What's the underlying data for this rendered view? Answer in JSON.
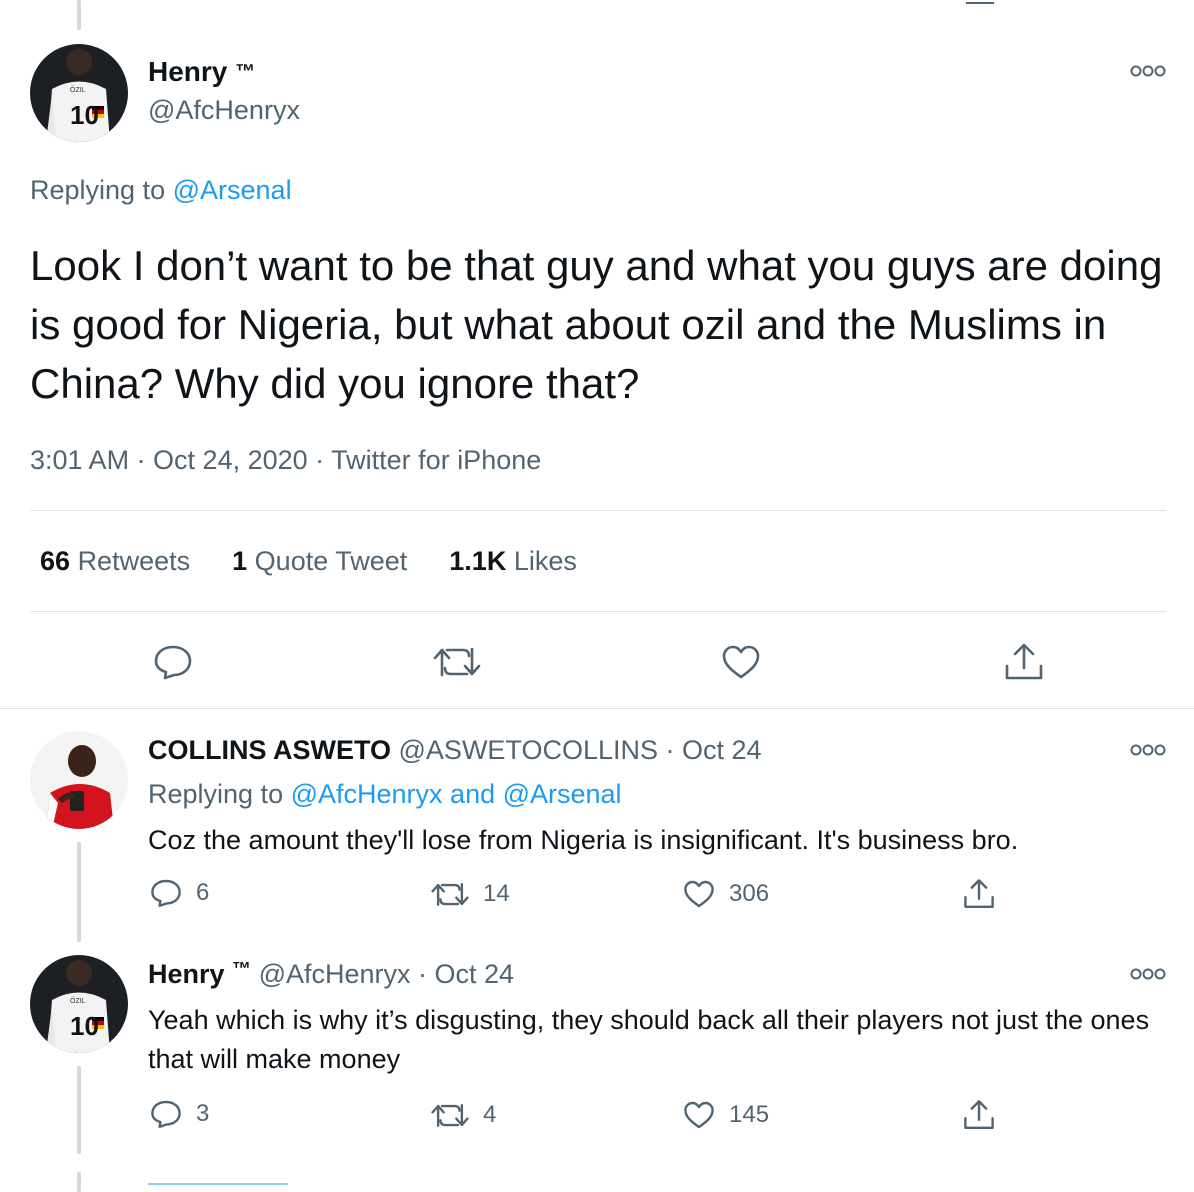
{
  "main_tweet": {
    "display_name": "Henry",
    "tm": "™",
    "handle": "@AfcHenryx",
    "replying_label": "Replying to",
    "replying_to": "@Arsenal",
    "text": "Look I don’t want to be that guy and what you guys are doing is good for Nigeria, but what about ozil and the Muslims in China? Why did you ignore that?",
    "timestamp": "3:01 AM · Oct 24, 2020 · Twitter for iPhone",
    "stats": {
      "retweets_count": "66",
      "retweets_label": "Retweets",
      "quotes_count": "1",
      "quotes_label": "Quote Tweet",
      "likes_count": "1.1K",
      "likes_label": "Likes"
    },
    "avatar_jersey": "10",
    "avatar_name": "ÖZIL"
  },
  "replies": [
    {
      "display_name": "COLLINS ASWETO",
      "handle": "@ASWETOCOLLINS",
      "date": "· Oct 24",
      "replying_label": "Replying to",
      "replying_to": "@AfcHenryx and @Arsenal",
      "text": "Coz the amount they'll lose from Nigeria is insignificant. It's business bro.",
      "reply_count": "6",
      "retweet_count": "14",
      "like_count": "306"
    },
    {
      "display_name": "Henry",
      "tm": "™",
      "handle": "@AfcHenryx",
      "date": "· Oct 24",
      "text": "Yeah which is why it’s disgusting, they should back all their players not just the ones that will make money",
      "reply_count": "3",
      "retweet_count": "4",
      "like_count": "145",
      "avatar_jersey": "10",
      "avatar_name": "ÖZIL"
    }
  ],
  "colors": {
    "link": "#1d9bf0",
    "muted": "#536471",
    "divider": "#dfe3e6",
    "thread_line": "#cfd9de"
  }
}
